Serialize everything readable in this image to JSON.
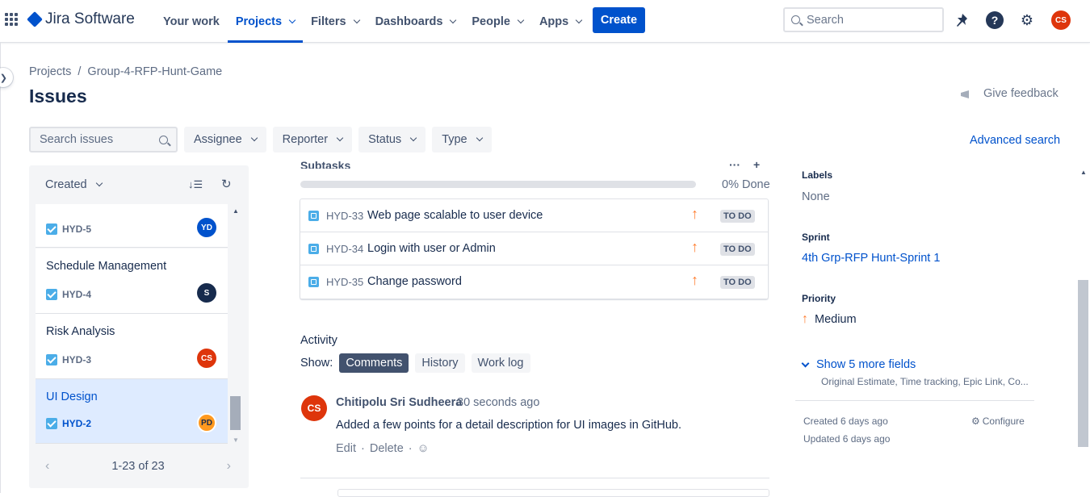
{
  "topbar": {
    "logo_text": "Jira Software",
    "nav": [
      {
        "label": "Your work"
      },
      {
        "label": "Projects"
      },
      {
        "label": "Filters"
      },
      {
        "label": "Dashboards"
      },
      {
        "label": "People"
      },
      {
        "label": "Apps"
      }
    ],
    "create_label": "Create",
    "search_placeholder": "Search",
    "user_initials": "CS",
    "accent": "#0052cc"
  },
  "breadcrumb": [
    "Projects",
    "/",
    "Group-4-RFP-Hunt-Game"
  ],
  "page_title": "Issues",
  "feedback_label": "Give feedback",
  "filters": {
    "search_placeholder": "Search issues",
    "buttons": [
      "Assignee",
      "Reporter",
      "Status",
      "Type"
    ],
    "advanced_search": "Advanced search"
  },
  "issue_list": {
    "sort_label": "Created",
    "cards": [
      {
        "title": "",
        "key": "HYD-5",
        "assignee": "YD",
        "color": "#0052cc"
      },
      {
        "title": "Schedule Management",
        "key": "HYD-4",
        "assignee": "S",
        "color": "#172b4d"
      },
      {
        "title": "Risk Analysis",
        "key": "HYD-3",
        "assignee": "CS",
        "color": "#de350b"
      },
      {
        "title": "UI Design",
        "key": "HYD-2",
        "assignee": "PD",
        "color": "#ff991f"
      }
    ],
    "pager": "1-23 of 23"
  },
  "subtasks": {
    "label": "Subtasks",
    "progress_fraction": 0,
    "progress_text": "0% Done",
    "items": [
      {
        "key": "HYD-33",
        "summary": "Web page scalable to user device",
        "status": "TO DO"
      },
      {
        "key": "HYD-34",
        "summary": "Login with user or Admin",
        "status": "TO DO"
      },
      {
        "key": "HYD-35",
        "summary": "Change password",
        "status": "TO DO"
      }
    ]
  },
  "activity": {
    "title": "Activity",
    "show_label": "Show:",
    "tabs": [
      "Comments",
      "History",
      "Work log"
    ],
    "comment": {
      "initials": "CS",
      "author": "Chitipolu Sri Sudheera",
      "time": "30 seconds ago",
      "body": "Added a few points for a detail description for UI images in GitHub.",
      "edit": "Edit",
      "delete": "Delete"
    }
  },
  "details": {
    "labels_label": "Labels",
    "labels_value": "None",
    "sprint_label": "Sprint",
    "sprint_value": "4th Grp-RFP Hunt-Sprint 1",
    "priority_label": "Priority",
    "priority_value": "Medium",
    "more_fields": "Show 5 more fields",
    "more_fields_sub": "Original Estimate, Time tracking, Epic Link, Co...",
    "created": "Created 6 days ago",
    "updated": "Updated 6 days ago",
    "configure": "Configure"
  }
}
